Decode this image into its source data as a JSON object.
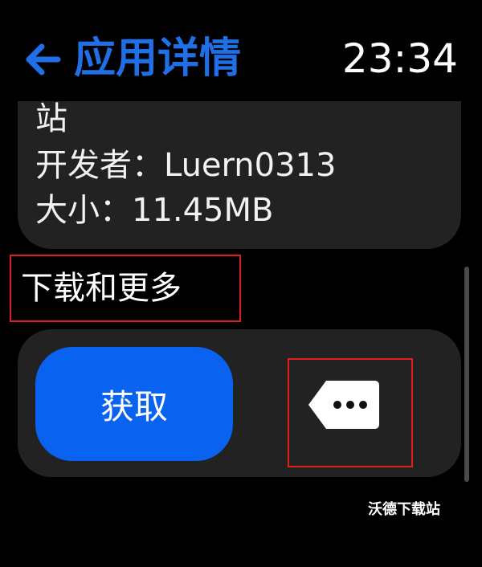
{
  "header": {
    "back_icon": "arrow-left-icon",
    "title": "应用详情",
    "clock": "23:34"
  },
  "info": {
    "line1": "站",
    "line2": "开发者：Luern0313",
    "line3": "大小：11.45MB"
  },
  "section": {
    "title": "下载和更多"
  },
  "actions": {
    "get_label": "获取",
    "more_icon": "more-options-icon"
  },
  "watermark": "沃德下载站",
  "colors": {
    "accent": "#1f6fe8",
    "button": "#0a63f0",
    "card": "#222222",
    "highlight": "#e21f1f"
  }
}
